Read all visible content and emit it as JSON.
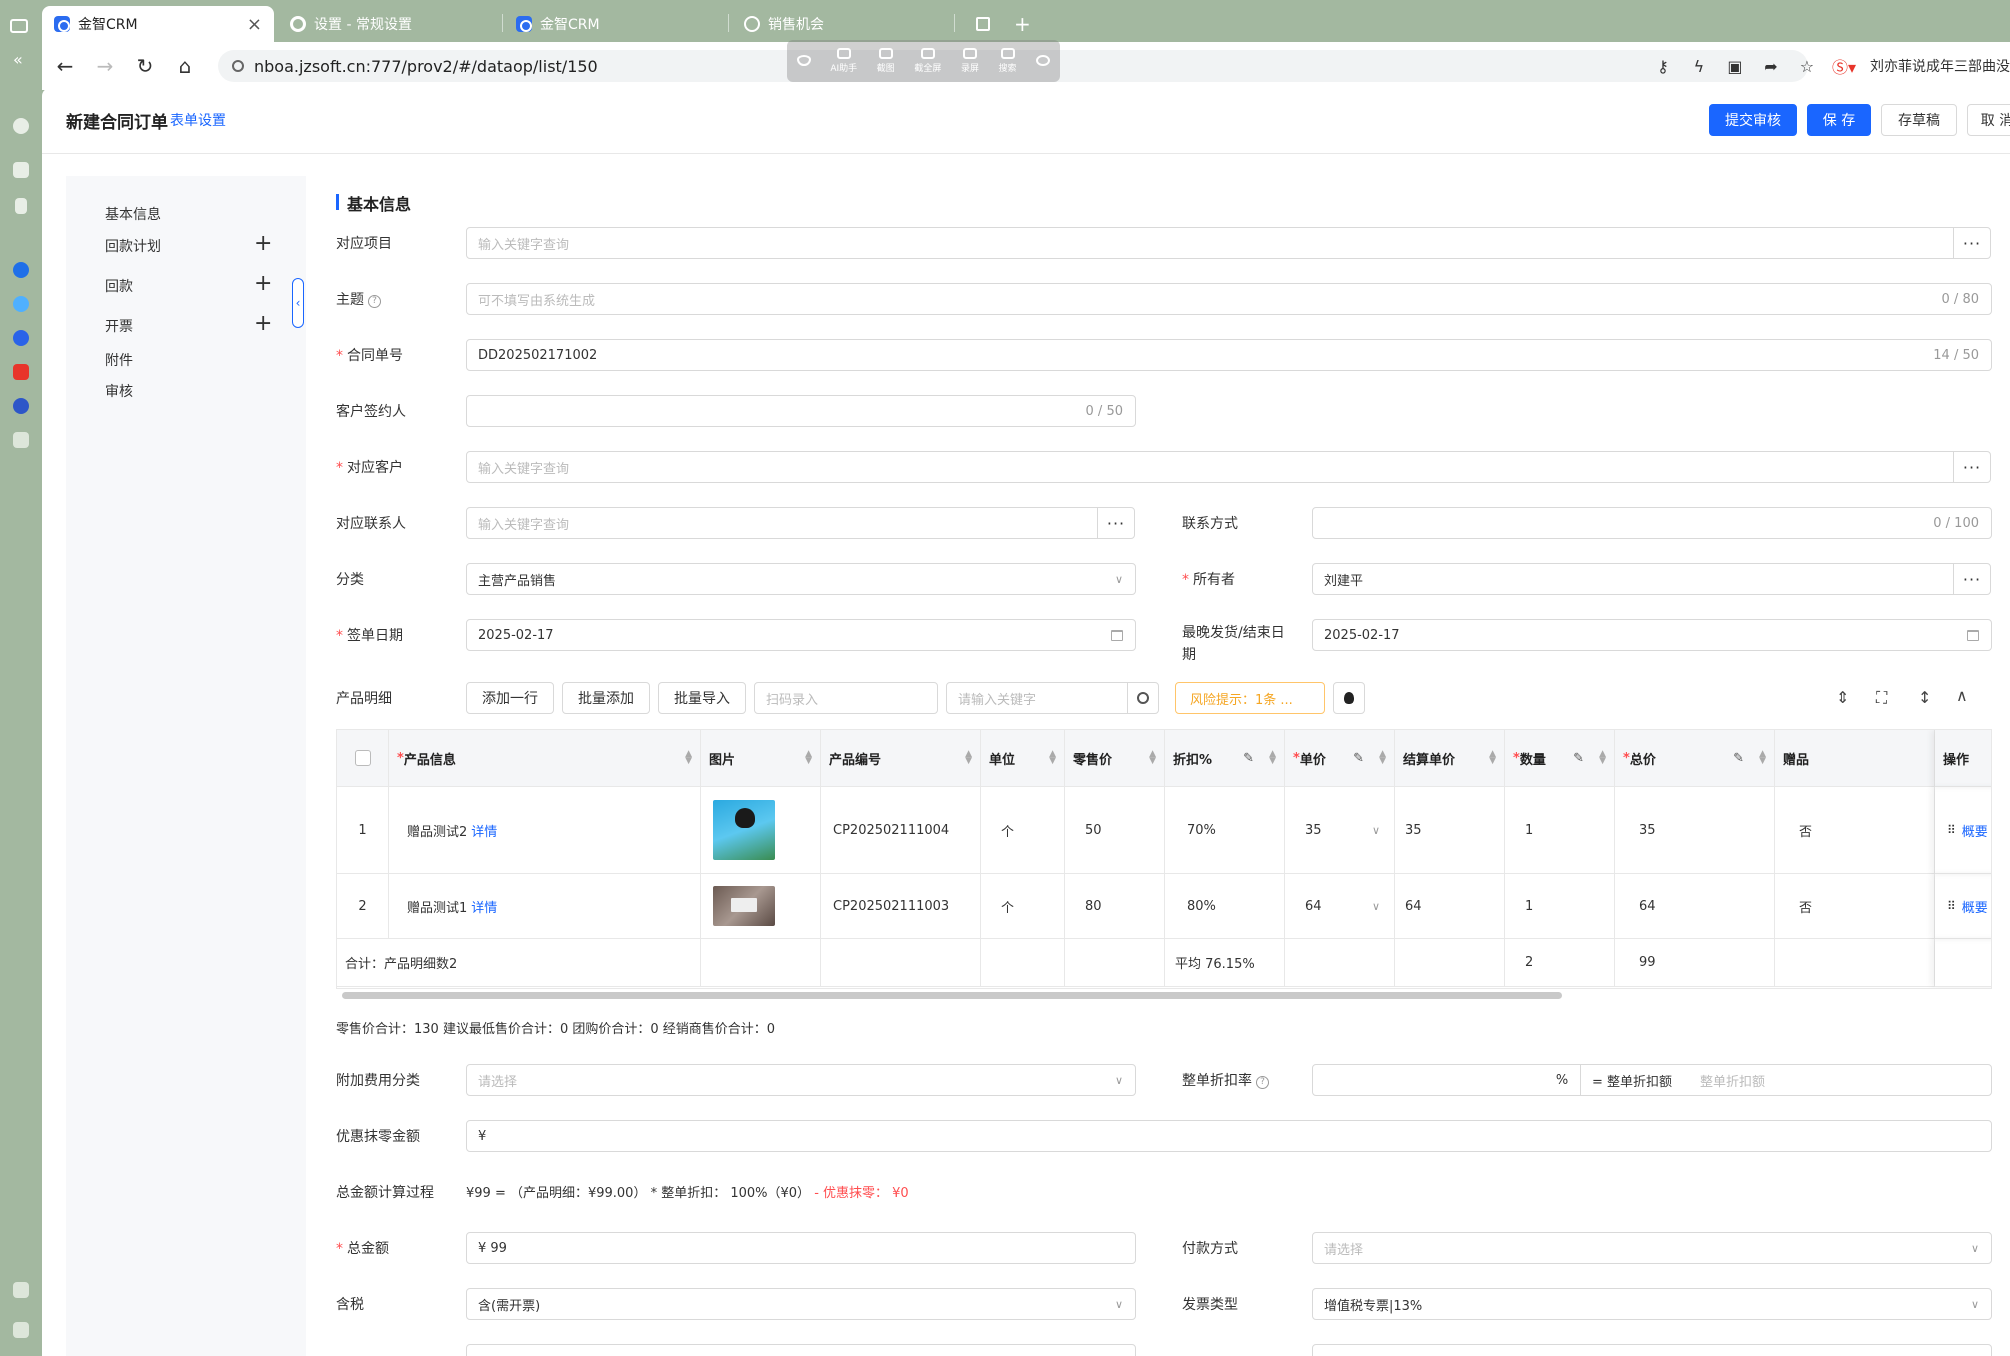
{
  "browser": {
    "tabs": [
      {
        "label": "金智CRM"
      },
      {
        "label": "设置 - 常规设置"
      },
      {
        "label": "金智CRM"
      },
      {
        "label": "销售机会"
      }
    ],
    "url": "nboa.jzsoft.cn:777/prov2/#/dataop/list/150",
    "floating_toolbar": [
      "AI助手",
      "截图",
      "截全屏",
      "录屏",
      "搜索"
    ],
    "news_ticker": "刘亦菲说成年三部曲没"
  },
  "header": {
    "title": "新建合同订单",
    "form_settings": "表单设置",
    "buttons": {
      "submit": "提交审核",
      "save": "保 存",
      "draft": "存草稿",
      "cancel": "取 消"
    }
  },
  "sidenav": {
    "items": [
      {
        "label": "基本信息",
        "plus": false
      },
      {
        "label": "回款计划",
        "plus": true
      },
      {
        "label": "回款",
        "plus": true
      },
      {
        "label": "开票",
        "plus": true
      },
      {
        "label": "附件",
        "plus": false
      },
      {
        "label": "审核",
        "plus": false
      }
    ]
  },
  "section": {
    "title": "基本信息"
  },
  "form": {
    "project": {
      "label": "对应项目",
      "placeholder": "输入关键字查询"
    },
    "subject": {
      "label": "主题",
      "placeholder": "可不填写由系统生成",
      "count": "0 / 80"
    },
    "contract_no": {
      "label": "合同单号",
      "value": "DD202502171002",
      "count": "14 / 50"
    },
    "signer": {
      "label": "客户签约人",
      "count": "0 / 50"
    },
    "customer": {
      "label": "对应客户",
      "placeholder": "输入关键字查询"
    },
    "contact": {
      "label": "对应联系人",
      "placeholder": "输入关键字查询"
    },
    "contact_method": {
      "label": "联系方式",
      "count": "0 / 100"
    },
    "category": {
      "label": "分类",
      "value": "主营产品销售"
    },
    "owner": {
      "label": "所有者",
      "value": "刘建平"
    },
    "sign_date": {
      "label": "签单日期",
      "value": "2025-02-17"
    },
    "latest_date": {
      "label_1": "最晚发货/结束日",
      "label_2": "期",
      "value": "2025-02-17"
    },
    "products_label": "产品明细",
    "extra_fee": {
      "label": "附加费用分类",
      "placeholder": "请选择"
    },
    "discount_rate": {
      "label": "整单折扣率",
      "pct": "%",
      "eq_label": "= 整单折扣额",
      "eq_placeholder": "整单折扣额"
    },
    "rounding": {
      "label": "优惠抹零金额",
      "value": "¥"
    },
    "calc": {
      "label": "总金额计算过程",
      "text": "¥99 = （产品明细：¥99.00） * 整单折扣： 100%（¥0）",
      "red": "- 优惠抹零： ¥0"
    },
    "total": {
      "label": "总金额",
      "value": "¥  99"
    },
    "payment": {
      "label": "付款方式",
      "placeholder": "请选择"
    },
    "tax": {
      "label": "含税",
      "value": "含(需开票)"
    },
    "invoice_type": {
      "label": "发票类型",
      "value": "增值税专票|13%"
    }
  },
  "product_toolbar": {
    "add_row": "添加一行",
    "batch_add": "批量添加",
    "batch_import": "批量导入",
    "scan_placeholder": "扫码录入",
    "search_placeholder": "请输入关键字",
    "risk": "风险提示：1条 ..."
  },
  "table": {
    "headers": {
      "product": "产品信息",
      "image": "图片",
      "code": "产品编号",
      "unit": "单位",
      "retail": "零售价",
      "discount": "折扣%",
      "price": "单价",
      "settle": "结算单价",
      "qty": "数量",
      "total": "总价",
      "gift": "赠品",
      "ops": "操作"
    },
    "rows": [
      {
        "idx": "1",
        "name": "赠品测试2",
        "detail": "详情",
        "code": "CP202502111004",
        "unit": "个",
        "retail": "50",
        "discount": "70%",
        "price": "35",
        "settle": "35",
        "qty": "1",
        "total": "35",
        "gift": "否",
        "op": "概要"
      },
      {
        "idx": "2",
        "name": "赠品测试1",
        "detail": "详情",
        "code": "CP202502111003",
        "unit": "个",
        "retail": "80",
        "discount": "80%",
        "price": "64",
        "settle": "64",
        "qty": "1",
        "total": "64",
        "gift": "否",
        "op": "概要"
      }
    ],
    "footer": {
      "label": "合计：产品明细数2",
      "discount": "平均 76.15%",
      "qty": "2",
      "total": "99"
    }
  },
  "summary": "零售价合计：130  建议最低售价合计：0  团购价合计：0  经销商售价合计：0"
}
